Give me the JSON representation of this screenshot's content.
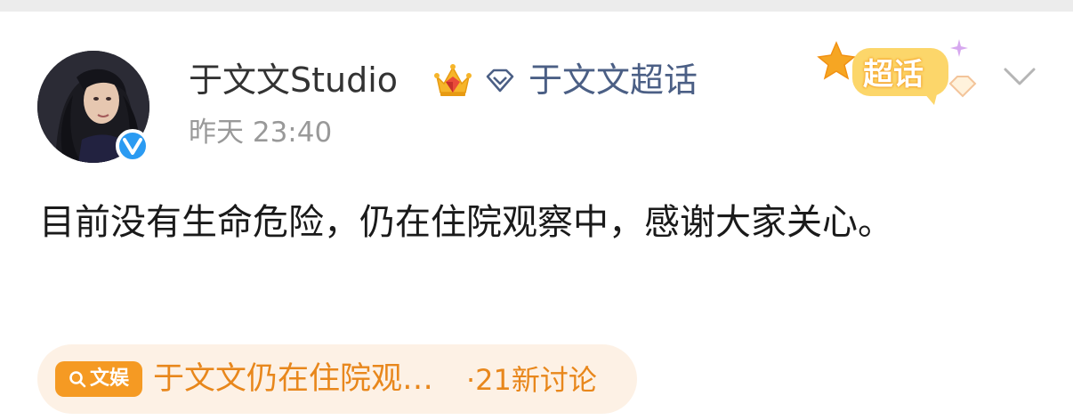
{
  "post": {
    "author": "于文文Studio",
    "supertopic": "于文文超话",
    "timestamp": "昨天 23:40",
    "text": "目前没有生命危险，仍在住院观察中，感谢大家关心。",
    "sticker_label": "超话"
  },
  "topic": {
    "badge_label": "文娱",
    "title": "于文文仍在住院观…",
    "count": "·21新讨论"
  },
  "icons": {
    "verified": "verified-badge-icon",
    "crown": "crown-icon",
    "supertopic": "diamond-icon",
    "search": "search-icon",
    "more": "chevron-down-icon"
  },
  "colors": {
    "author_text": "#333333",
    "link_blue": "#4b5f85",
    "timestamp": "#999999",
    "verified_blue": "#2b9bf2",
    "topic_orange": "#e8871c",
    "topic_bg": "#fdf1e5",
    "badge_orange": "#f59a23"
  }
}
